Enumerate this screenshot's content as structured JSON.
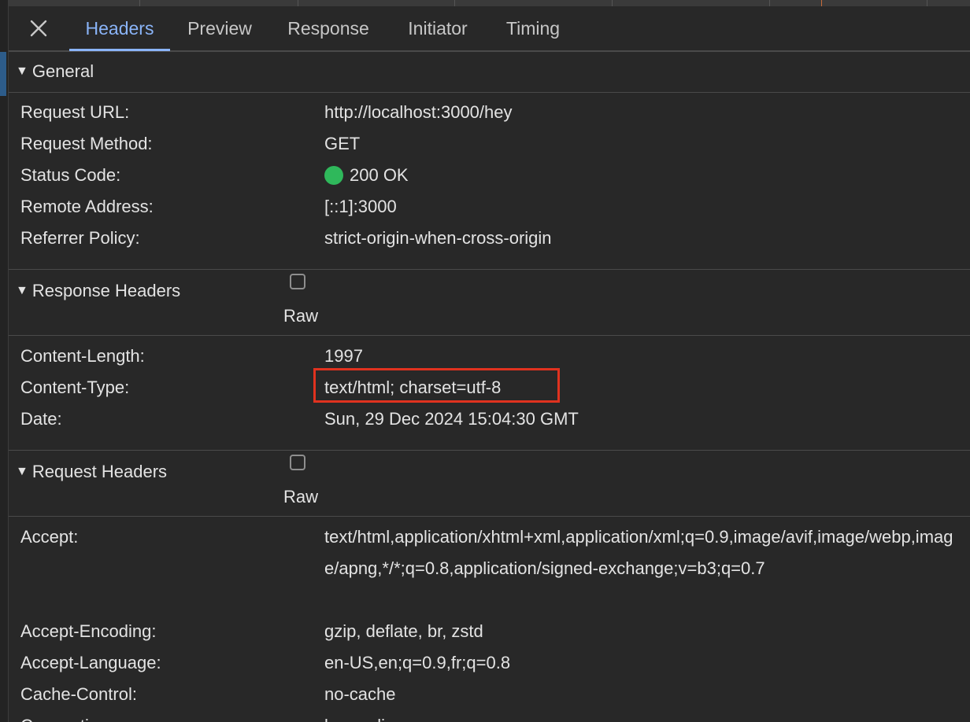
{
  "tabs": [
    {
      "label": "Headers",
      "active": true
    },
    {
      "label": "Preview",
      "active": false
    },
    {
      "label": "Response",
      "active": false
    },
    {
      "label": "Initiator",
      "active": false
    },
    {
      "label": "Timing",
      "active": false
    }
  ],
  "general": {
    "title": "General",
    "rows": [
      {
        "key": "Request URL:",
        "value": "http://localhost:3000/hey"
      },
      {
        "key": "Request Method:",
        "value": "GET"
      },
      {
        "key": "Status Code:",
        "value": "200 OK"
      },
      {
        "key": "Remote Address:",
        "value": "[::1]:3000"
      },
      {
        "key": "Referrer Policy:",
        "value": "strict-origin-when-cross-origin"
      }
    ]
  },
  "response_headers": {
    "title": "Response Headers",
    "raw_label": "Raw",
    "rows": [
      {
        "key": "Content-Length:",
        "value": "1997"
      },
      {
        "key": "Content-Type:",
        "value": "text/html; charset=utf-8"
      },
      {
        "key": "Date:",
        "value": "Sun, 29 Dec 2024 15:04:30 GMT"
      }
    ]
  },
  "request_headers": {
    "title": "Request Headers",
    "raw_label": "Raw",
    "rows": [
      {
        "key": "Accept:",
        "value": "text/html,application/xhtml+xml,application/xml;q=0.9,image/avif,image/webp,image/apng,*/*;q=0.8,application/signed-exchange;v=b3;q=0.7"
      },
      {
        "key": "Accept-Encoding:",
        "value": "gzip, deflate, br, zstd"
      },
      {
        "key": "Accept-Language:",
        "value": "en-US,en;q=0.9,fr;q=0.8"
      },
      {
        "key": "Cache-Control:",
        "value": "no-cache"
      },
      {
        "key": "Connection:",
        "value": "keep-alive"
      }
    ]
  },
  "colors": {
    "background": "#282828",
    "accent": "#8ab4f8",
    "status_ok": "#2fb85b",
    "highlight": "#e0321f"
  },
  "icons": {
    "close": "close-icon",
    "expand": "triangle-down-icon"
  }
}
